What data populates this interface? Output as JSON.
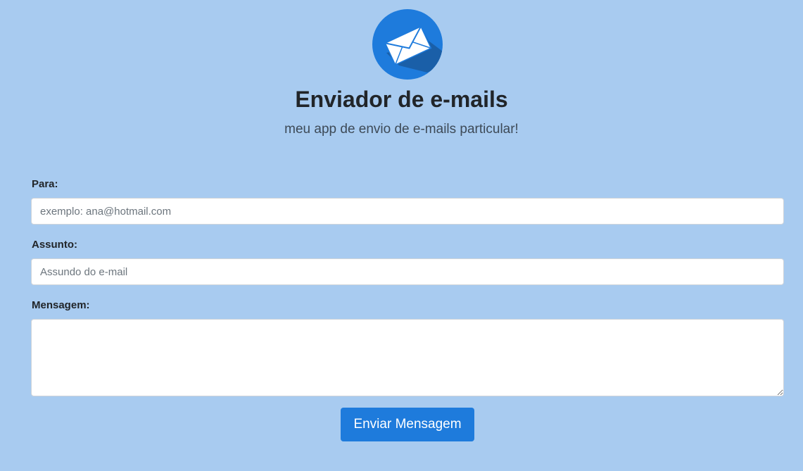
{
  "colors": {
    "background": "#a8cbf0",
    "accent": "#1e7bdc",
    "logo_circle": "#1e7bdc",
    "logo_shadow": "#1a5fa8"
  },
  "header": {
    "logo_icon": "envelope-icon",
    "title": "Enviador de e-mails",
    "subtitle": "meu app de envio de e-mails particular!"
  },
  "form": {
    "to": {
      "label": "Para:",
      "placeholder": "exemplo: ana@hotmail.com",
      "value": ""
    },
    "subject": {
      "label": "Assunto:",
      "placeholder": "Assundo do e-mail",
      "value": ""
    },
    "message": {
      "label": "Mensagem:",
      "value": ""
    },
    "submit_label": "Enviar Mensagem"
  }
}
